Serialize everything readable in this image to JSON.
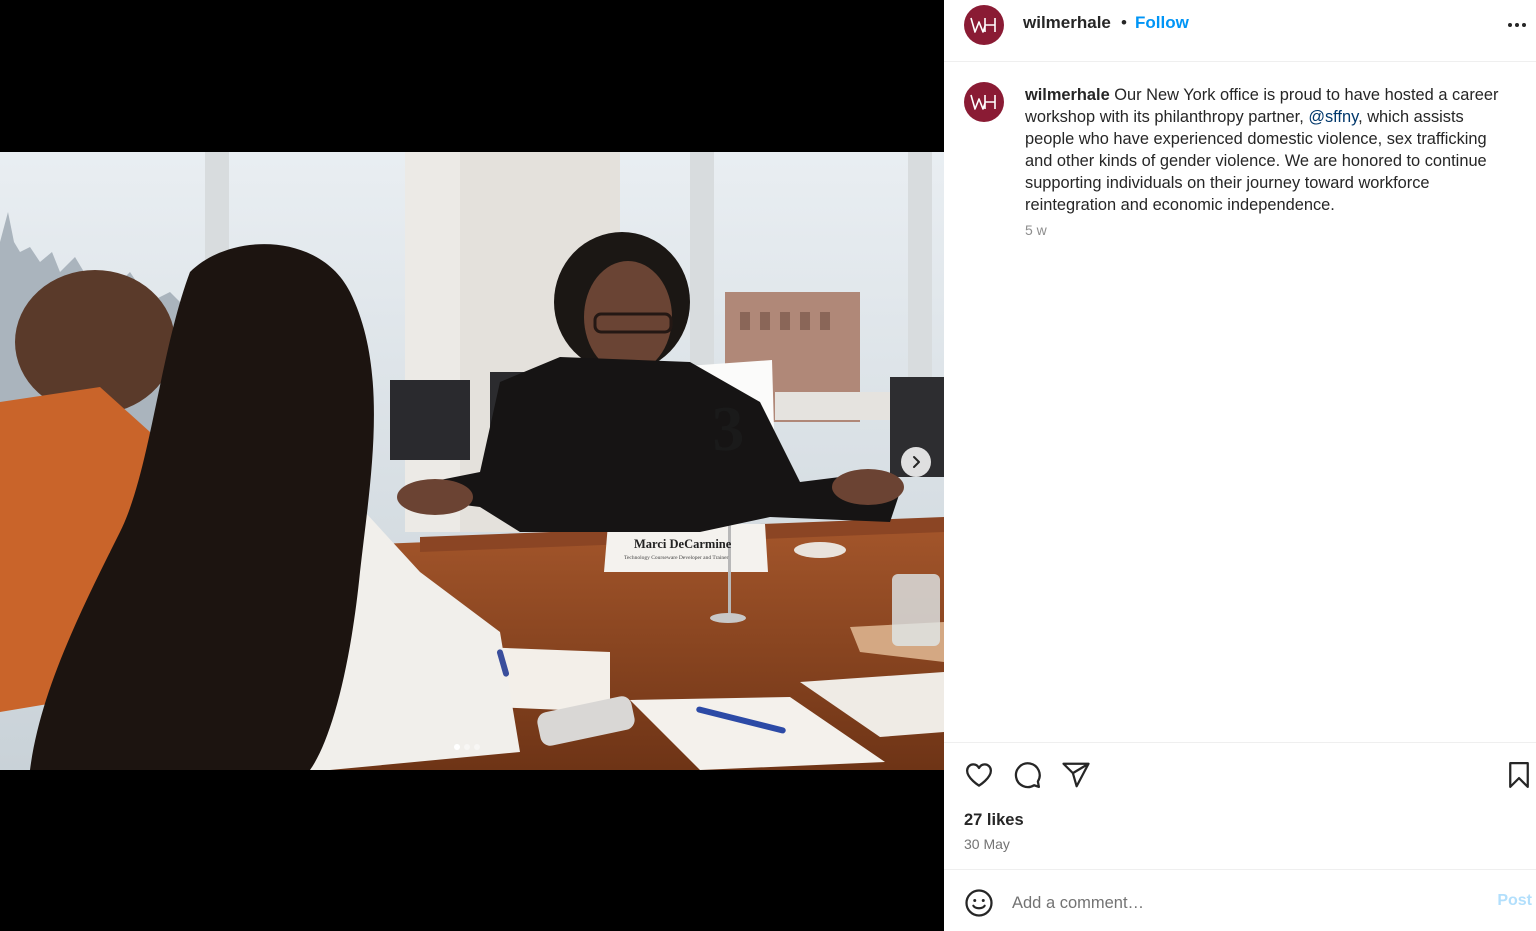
{
  "post": {
    "username": "wilmerhale",
    "separator": "•",
    "follow_label": "Follow",
    "more_label": "•••",
    "avatar_initials": "WH",
    "caption_text": " Our New York office is proud to have hosted a career workshop with its philanthropy partner, ",
    "caption_mention": "@sffny",
    "caption_text_end": ", which assists people who have experienced domestic violence, sex trafficking and other kinds of gender violence. We are honored to continue supporting individuals on their journey toward workforce reintegration and economic independence.",
    "age": "5 w",
    "likes": "27 likes",
    "date": "30 May",
    "comment_placeholder": "Add a comment…",
    "post_label": "Post"
  },
  "media": {
    "table_number": "3",
    "name_card_name": "Marci DeCarmine",
    "name_card_title": "Technology Courseware Developer and Trainer",
    "carousel": {
      "count": 3,
      "active": 1
    }
  },
  "icons": {
    "like": "heart-icon",
    "comment": "comment-icon",
    "share": "share-icon",
    "save": "bookmark-icon",
    "emoji": "emoji-icon",
    "next": "chevron-right-icon",
    "more": "more-icon"
  },
  "colors": {
    "brand": "#8a1b34",
    "follow": "#0095f6",
    "mention": "#00376b",
    "post_disabled": "#b2dffc"
  }
}
